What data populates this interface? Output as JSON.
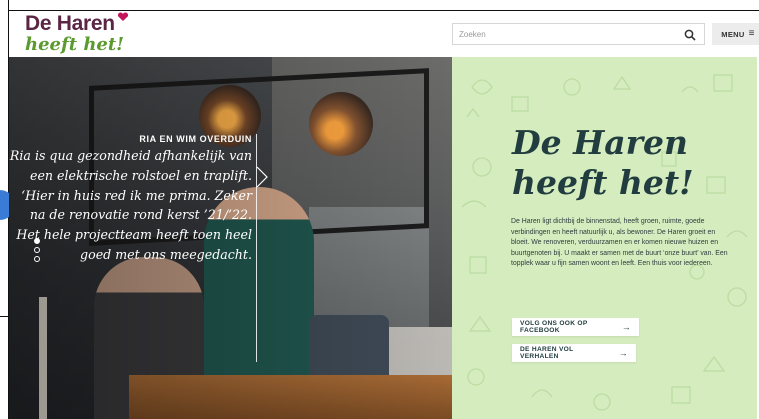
{
  "header": {
    "logo_line1": "De Haren",
    "logo_line2": "heeft het!",
    "search_placeholder": "Zoeken",
    "menu_label": "MENU",
    "menu_icon": "≡"
  },
  "hero": {
    "quote_name": "RIA EN WIM OVERDUIN",
    "quote_text": "Ria is qua gezondheid afhankelijk van een elektrische rolstoel en traplift. ‘Hier in huis red ik me prima. Zeker na de renovatie rond kerst ’21/’22. Het hele projectteam heeft toen heel goed met ons meegedacht.",
    "slide_count": 3,
    "active_slide": 1
  },
  "panel": {
    "title_line1": "De Haren",
    "title_line2": "heeft het!",
    "body": "De Haren ligt dichtbij de binnenstad, heeft groen, ruimte, goede verbindingen en heeft natuurlijk u, als bewoner. De Haren groeit en bloeit. We renoveren, verduurzamen en er komen nieuwe huizen en buurtgenoten bij. U maakt er samen met de buurt ‘onze buurt’ van. Een topplek waar u fijn samen woont en leeft. Een thuis voor iedereen.",
    "button1": "VOLG ONS OOK OP FACEBOOK",
    "button2": "DE HAREN VOL VERHALEN",
    "arrow": "→"
  },
  "colors": {
    "brand_purple": "#5b2546",
    "brand_green": "#5b9a2f",
    "panel_bg": "#d4ecbe",
    "title_color": "#223d3f"
  },
  "icons": [
    "search-icon",
    "menu-icon",
    "chevron-right-icon",
    "heart-icon",
    "arrow-right-icon"
  ]
}
